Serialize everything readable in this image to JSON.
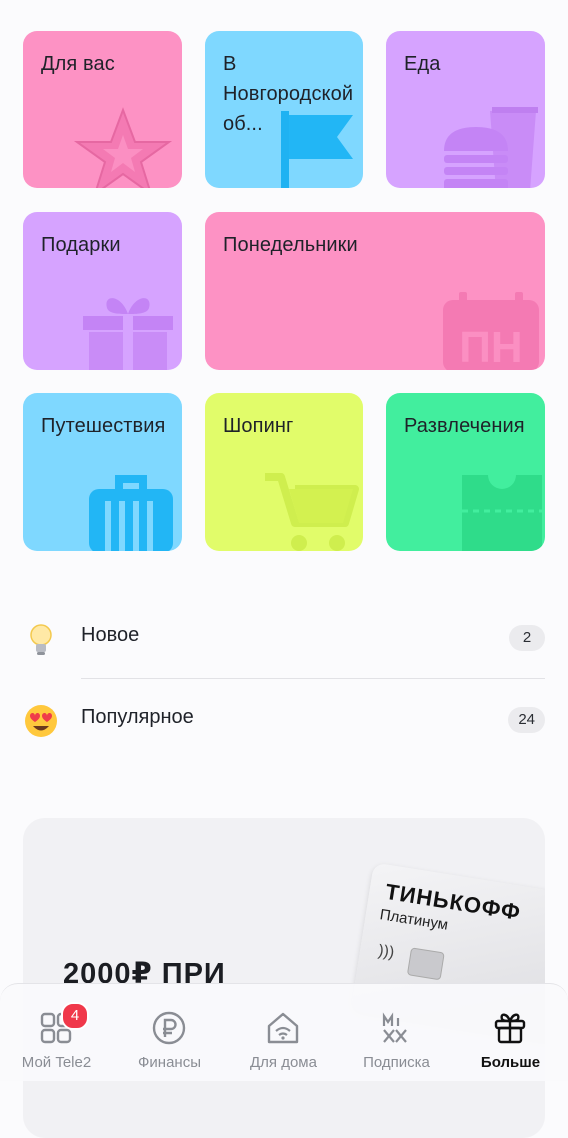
{
  "categories": [
    {
      "label": "Для вас",
      "color": "#fd92c4",
      "icon": "star-icon"
    },
    {
      "label": "В Новгородской об...",
      "color": "#7fd8ff",
      "icon": "flag-icon"
    },
    {
      "label": "Еда",
      "color": "#d6a3ff",
      "icon": "burger-drink-icon"
    },
    {
      "label": "Подарки",
      "color": "#d6a3ff",
      "icon": "gift-icon"
    },
    {
      "label": "Понедельники",
      "color": "#fd92c4",
      "icon": "calendar-monday-icon",
      "icon_text": "ПН"
    },
    {
      "label": "Путешествия",
      "color": "#7fd8ff",
      "icon": "suitcase-icon"
    },
    {
      "label": "Шопинг",
      "color": "#e1fc6a",
      "icon": "shopping-cart-icon"
    },
    {
      "label": "Развлечения",
      "color": "#42ee9e",
      "icon": "ticket-icon"
    }
  ],
  "lists": [
    {
      "label": "Новое",
      "count": "2",
      "icon": "light-bulb-icon"
    },
    {
      "label": "Популярное",
      "count": "24",
      "icon": "heart-eyes-emoji-icon"
    }
  ],
  "promo": {
    "title": "2000₽ ПРИ",
    "card_brand": "ТИНЬКОФФ",
    "card_sub": "Платинум"
  },
  "nav": [
    {
      "label": "Мой Tele2",
      "icon": "grid-icon",
      "badge": "4",
      "active": false
    },
    {
      "label": "Финансы",
      "icon": "ruble-icon",
      "active": false
    },
    {
      "label": "Для дома",
      "icon": "home-wifi-icon",
      "active": false
    },
    {
      "label": "Подписка",
      "icon": "mix-logo-icon",
      "active": false
    },
    {
      "label": "Больше",
      "icon": "gift-icon",
      "active": true
    }
  ]
}
